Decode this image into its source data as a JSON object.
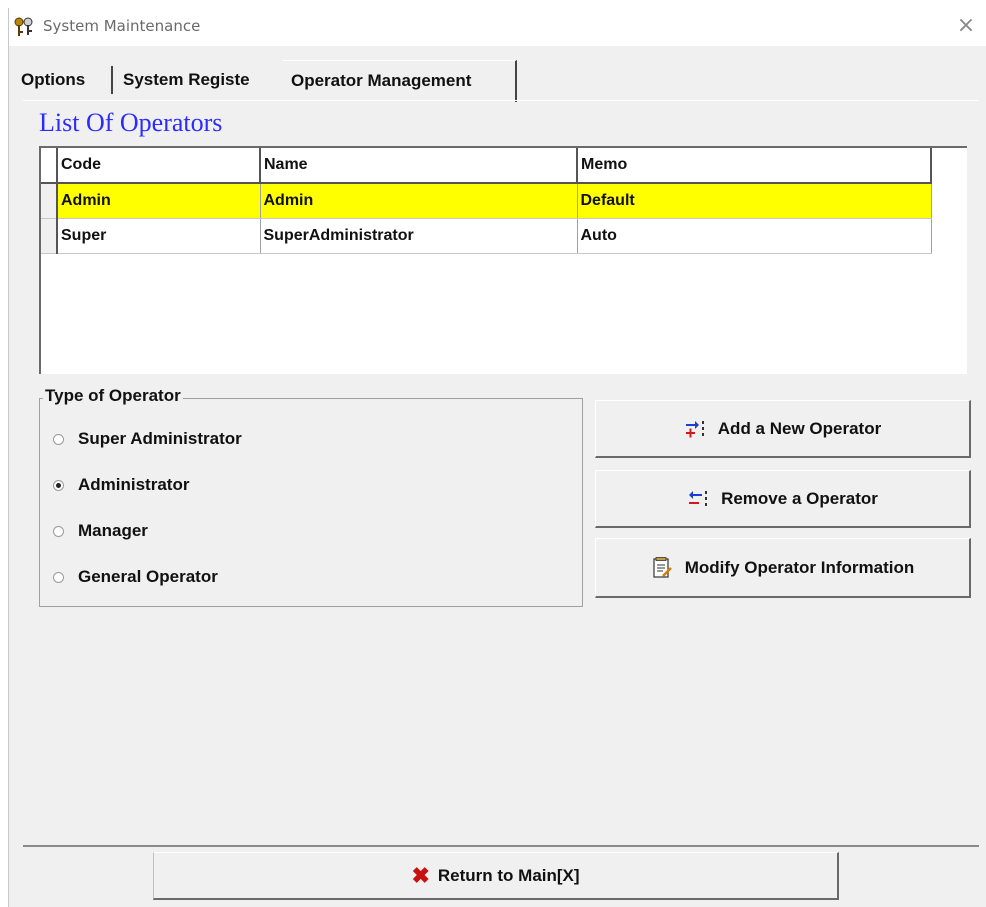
{
  "window": {
    "title": "System Maintenance",
    "close_symbol": "×"
  },
  "tabs": [
    {
      "label": "Options",
      "active": false
    },
    {
      "label": "System Registe",
      "active": false
    },
    {
      "label": "Operator Management",
      "active": true
    }
  ],
  "operators_list": {
    "title": "List Of Operators",
    "columns": [
      "Code",
      "Name",
      "Memo"
    ],
    "rows": [
      {
        "code": "Admin",
        "name": "Admin",
        "memo": "Default",
        "selected": true
      },
      {
        "code": "Super",
        "name": "SuperAdministrator",
        "memo": "Auto",
        "selected": false
      }
    ],
    "selected_row_color": "#ffff00"
  },
  "operator_type": {
    "title": "Type of Operator",
    "options": [
      {
        "label": "Super Administrator",
        "checked": false
      },
      {
        "label": "Administrator",
        "checked": true
      },
      {
        "label": "Manager",
        "checked": false
      },
      {
        "label": "General Operator",
        "checked": false
      }
    ]
  },
  "actions": {
    "add_label": "Add a New Operator",
    "add_icon": "add-operator-icon",
    "remove_label": "Remove a Operator",
    "remove_icon": "remove-operator-icon",
    "modify_label": "Modify Operator Information",
    "modify_icon": "modify-document-icon"
  },
  "footer": {
    "return_label": "Return to Main[X]",
    "return_icon": "red-x-icon",
    "return_icon_color": "#c81010"
  },
  "colors": {
    "list_title": "#2b2bff",
    "background": "#f0f0f0"
  }
}
